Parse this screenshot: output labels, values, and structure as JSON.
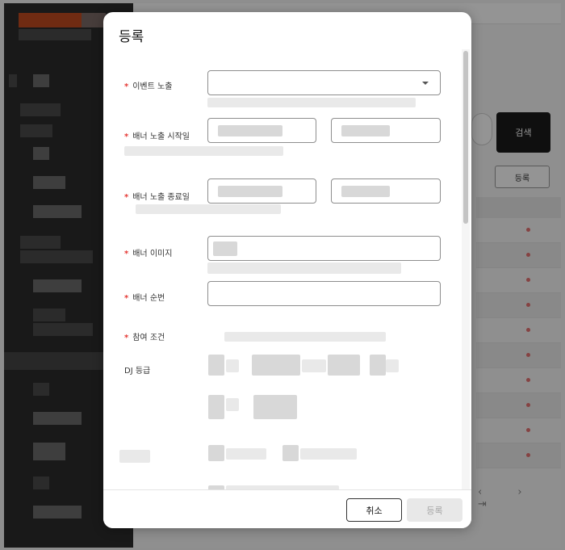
{
  "background": {
    "search_label": "검색",
    "register_label": "등록"
  },
  "modal": {
    "title": "등록",
    "fields": {
      "event_exposure": {
        "label": "이벤트 노출",
        "required": true
      },
      "banner_start": {
        "label": "배너 노출 시작일",
        "required": true
      },
      "banner_end": {
        "label": "배너 노출 종료일",
        "required": true
      },
      "banner_image": {
        "label": "배너 이미지",
        "required": true
      },
      "banner_order": {
        "label": "배너 순번",
        "required": true
      },
      "participation": {
        "label": "참여 조건",
        "required": true
      },
      "dj_grade": {
        "label": "DJ 등급",
        "required": false
      }
    },
    "footer": {
      "cancel_label": "취소",
      "submit_label": "등록"
    }
  },
  "colors": {
    "required_mark": "#e53935",
    "sidebar": "#2b2b2b",
    "sidebar_accent": "#c24a20",
    "primary_button": "#1b1b1b"
  },
  "icons": {
    "dropdown": "chevron-down-icon"
  }
}
